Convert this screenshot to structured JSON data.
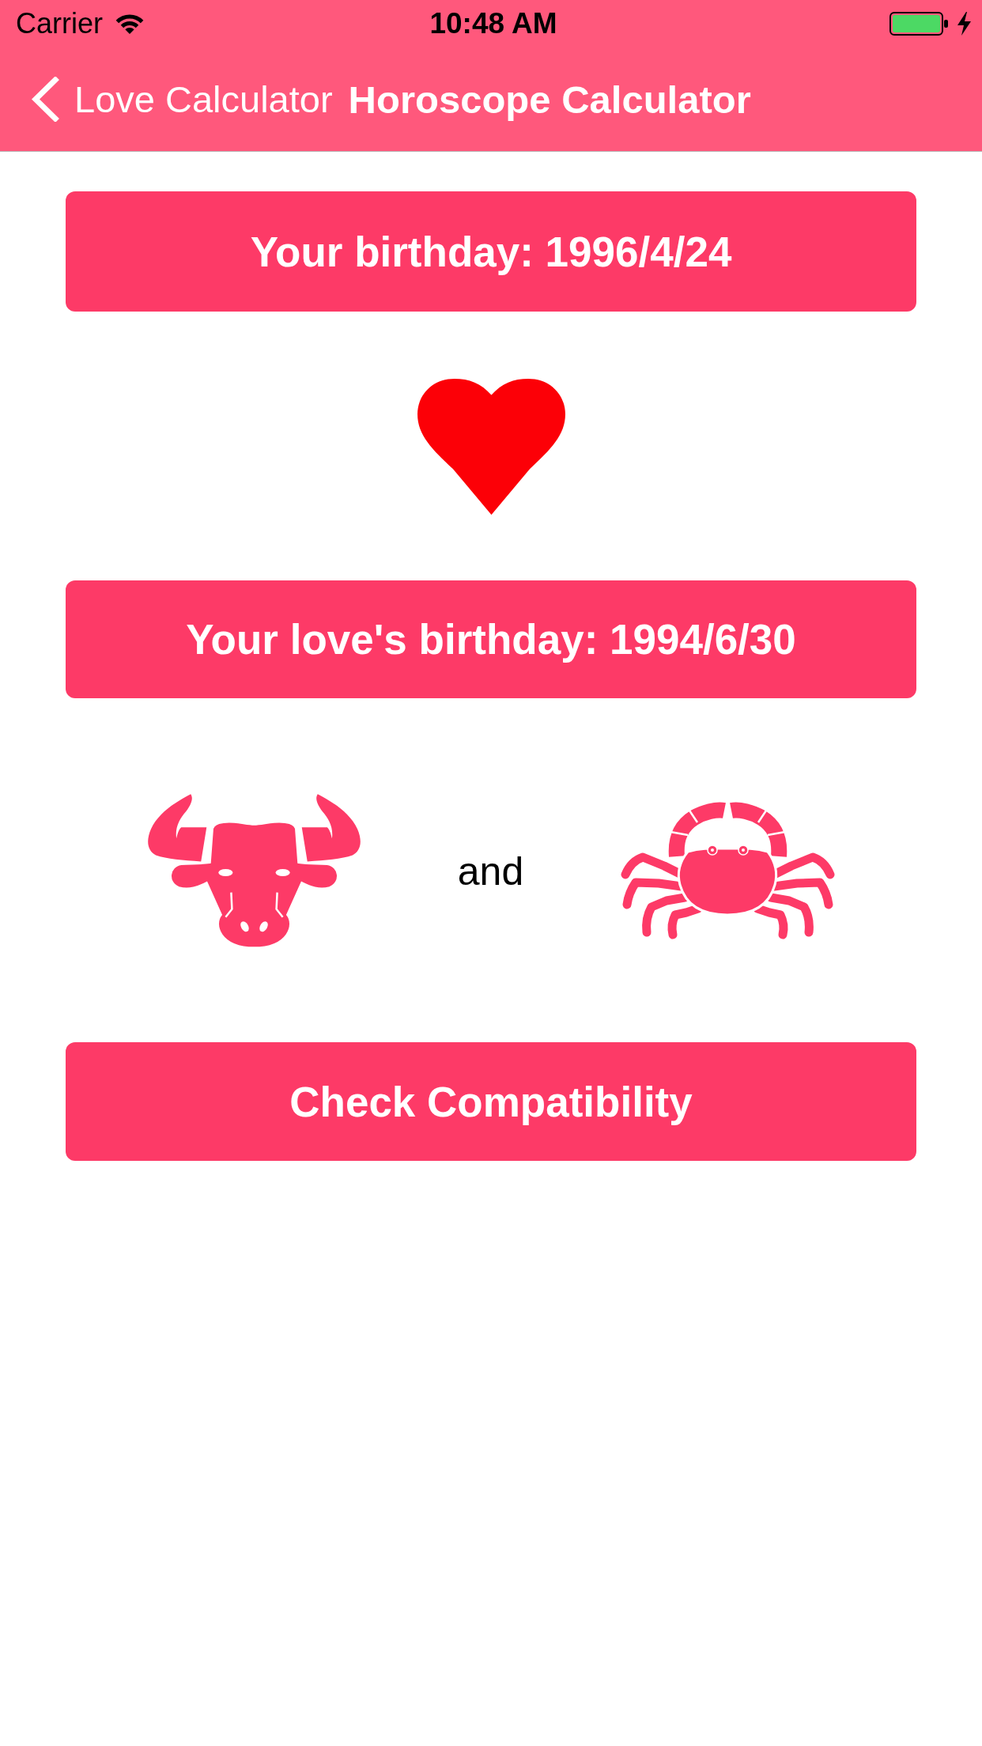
{
  "status_bar": {
    "carrier": "Carrier",
    "time": "10:48 AM"
  },
  "nav_bar": {
    "back_label": "Love Calculator",
    "title": "Horoscope Calculator"
  },
  "your_birthday_button": {
    "label": "Your birthday: 1996/4/24"
  },
  "love_birthday_button": {
    "label": "Your love's birthday: 1994/6/30"
  },
  "signs": {
    "separator": "and"
  },
  "check_button": {
    "label": "Check Compatibility"
  }
}
